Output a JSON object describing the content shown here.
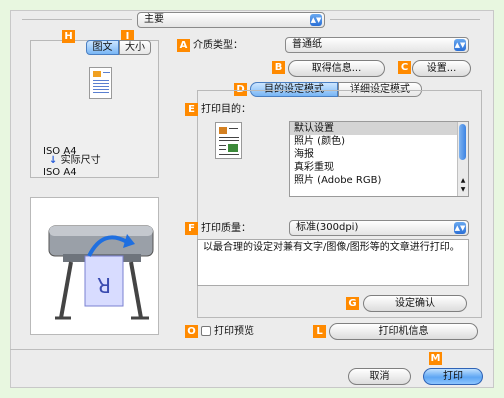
{
  "top_popup": {
    "value": "主要"
  },
  "badges": {
    "A": "A",
    "B": "B",
    "C": "C",
    "D": "D",
    "E": "E",
    "F": "F",
    "G": "G",
    "H": "H",
    "I": "I",
    "L": "L",
    "M": "M",
    "O": "O"
  },
  "preview_tabs": [
    "图文",
    "大小"
  ],
  "media": {
    "label": "介质类型：",
    "value": "普通纸"
  },
  "buttons": {
    "get_info": "取得信息...",
    "settings": "设置...",
    "confirm": "设定确认",
    "printer_info": "打印机信息",
    "cancel": "取消",
    "print": "打印"
  },
  "mode_tabs": [
    "目的设定模式",
    "详细设定模式"
  ],
  "purpose": {
    "label": "打印目的：",
    "items": [
      "默认设置",
      "照片 (颜色)",
      "海报",
      "真彩重现",
      "照片 (Adobe RGB)"
    ],
    "selected_index": 0
  },
  "paper_info": {
    "size1": "ISO A4",
    "arrow_label": "实际尺寸",
    "size2": "ISO A4"
  },
  "quality": {
    "label": "打印质量：",
    "value": "标准(300dpi)"
  },
  "description": "以最合理的设定对兼有文字/图像/图形等的文章进行打印。",
  "print_preview": {
    "label": "打印预览",
    "checked": false
  },
  "printer_image": {
    "glyph": "R"
  }
}
